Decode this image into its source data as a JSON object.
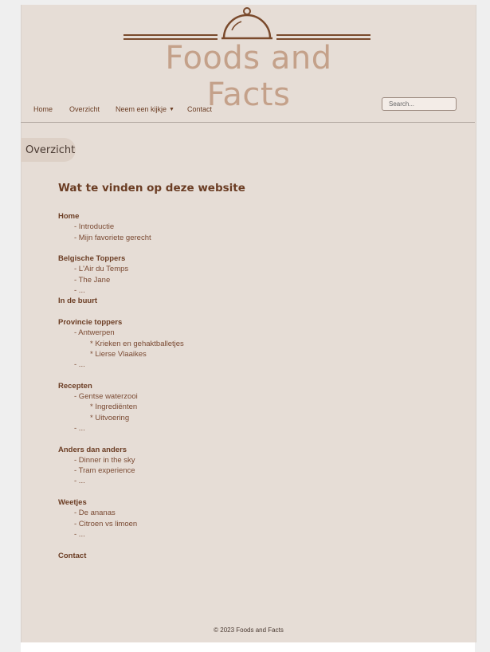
{
  "brand": {
    "title": "Foods and Facts",
    "logo_icon": "cloche-icon",
    "color": "#c4a18a",
    "accent": "#7a4a2c"
  },
  "nav": {
    "items": [
      {
        "label": "Home"
      },
      {
        "label": "Overzicht"
      },
      {
        "label": "Neem een kijkje",
        "dropdown": true
      },
      {
        "label": "Contact"
      }
    ],
    "search_placeholder": "Search..."
  },
  "page_tab": "Overzicht",
  "main": {
    "heading": "Wat te vinden op deze website",
    "sections": [
      {
        "title": "Home",
        "items": [
          {
            "text": "- Introductie",
            "children": []
          },
          {
            "text": "- Mijn favoriete gerecht",
            "children": []
          }
        ]
      },
      {
        "title": "Belgische Toppers",
        "items": [
          {
            "text": "- L'Air du Temps",
            "children": []
          },
          {
            "text": "- The Jane",
            "children": []
          },
          {
            "text": "- ...",
            "children": []
          }
        ]
      },
      {
        "title": "In de buurt",
        "items": []
      },
      {
        "title": "Provincie toppers",
        "items": [
          {
            "text": "- Antwerpen",
            "children": [
              "* Krieken en gehaktballetjes",
              "* Lierse Vlaaikes"
            ]
          },
          {
            "text": "- ...",
            "children": []
          }
        ]
      },
      {
        "title": "Recepten",
        "items": [
          {
            "text": "- Gentse waterzooi",
            "children": [
              "* Ingrediënten",
              "* Uitvoering"
            ]
          },
          {
            "text": "- ...",
            "children": []
          }
        ]
      },
      {
        "title": "Anders dan anders",
        "items": [
          {
            "text": "- Dinner in the sky",
            "children": []
          },
          {
            "text": "- Tram experience",
            "children": []
          },
          {
            "text": "- ...",
            "children": []
          }
        ]
      },
      {
        "title": "Weetjes",
        "items": [
          {
            "text": "- De ananas",
            "children": []
          },
          {
            "text": "- Citroen vs limoen",
            "children": []
          },
          {
            "text": "- ...",
            "children": []
          }
        ]
      },
      {
        "title": "Contact",
        "items": []
      }
    ]
  },
  "footer": {
    "text": "© 2023 Foods and Facts"
  }
}
